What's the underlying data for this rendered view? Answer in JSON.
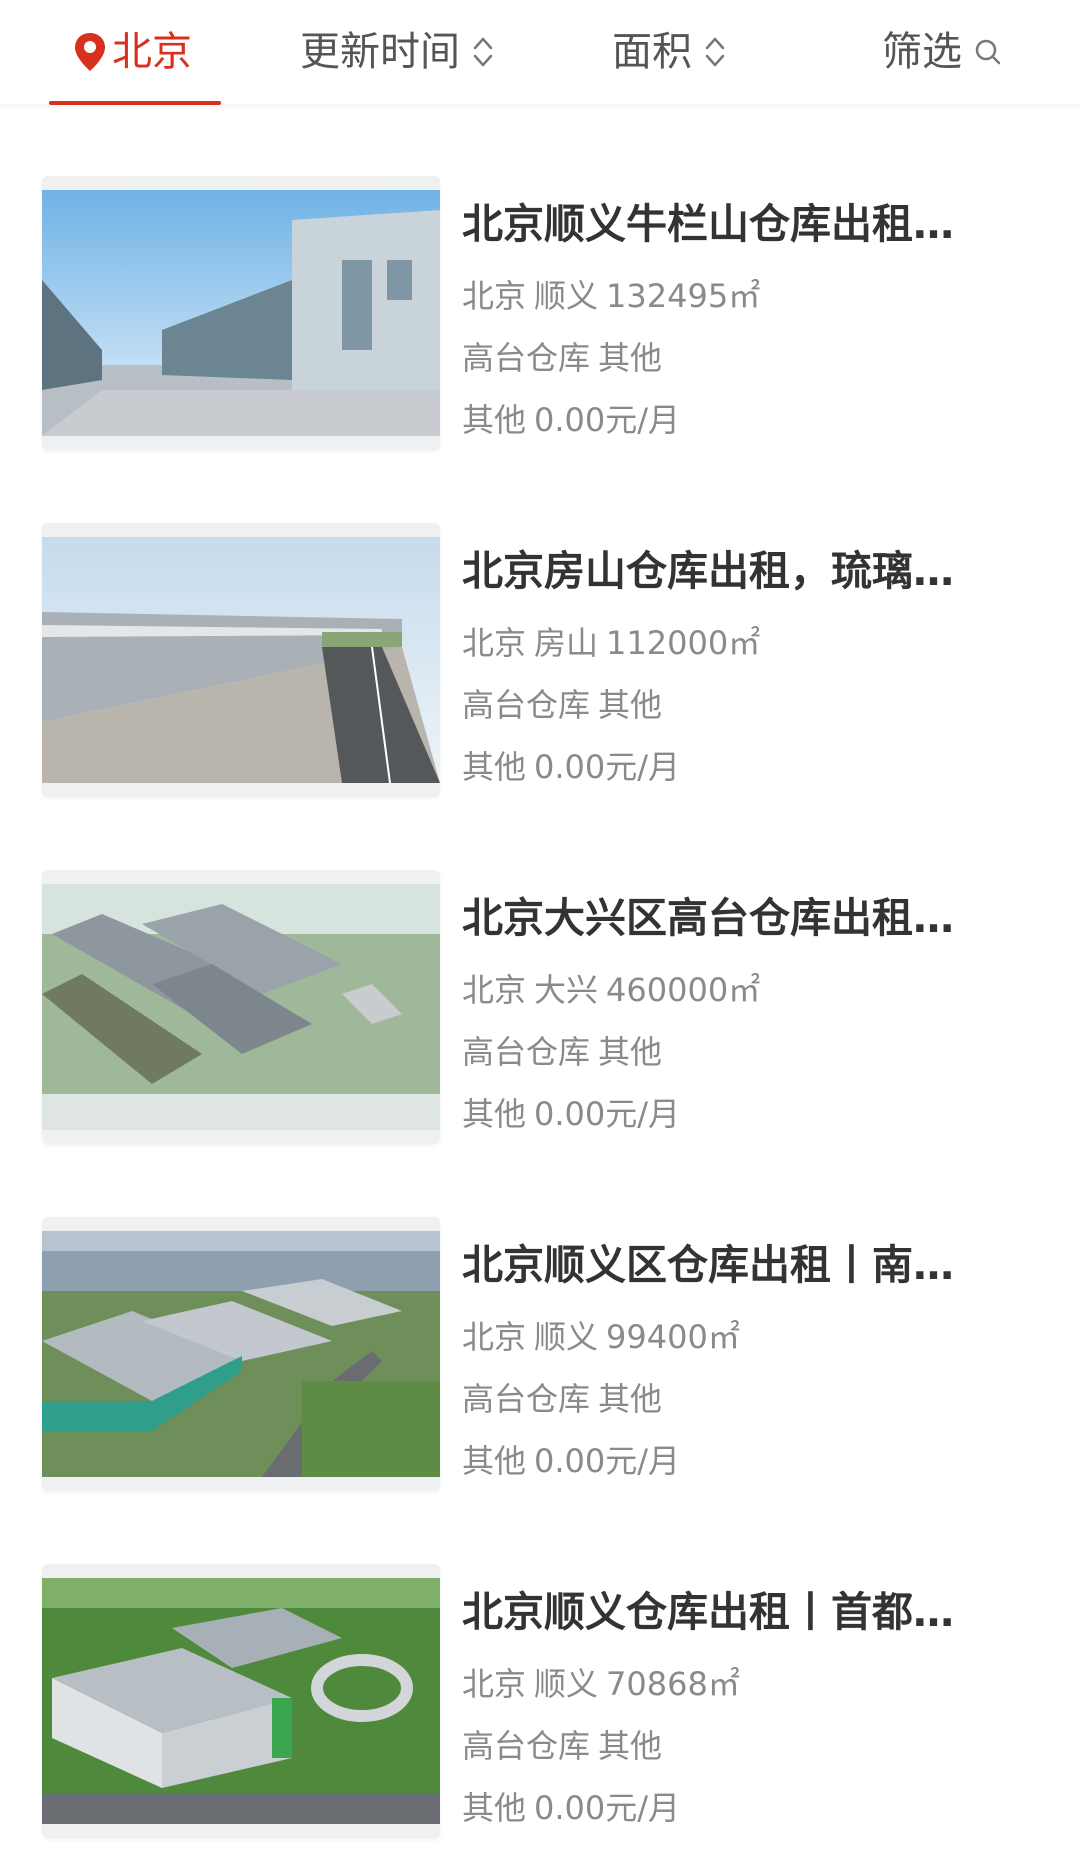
{
  "filter_bar": {
    "city": "北京",
    "sort_update": "更新时间",
    "sort_area": "面积",
    "filter": "筛选"
  },
  "colors": {
    "accent": "#d8301e",
    "title_text": "#333333",
    "meta_text": "#8a8a8a"
  },
  "listings": [
    {
      "title": "北京顺义牛栏山仓库出租…",
      "city": "北京",
      "district": "顺义",
      "area": "132495㎡",
      "warehouse_type": "高台仓库",
      "category": "其他",
      "price_type": "其他",
      "price": "0.00元/月"
    },
    {
      "title": "北京房山仓库出租，琉璃…",
      "city": "北京",
      "district": "房山",
      "area": "112000㎡",
      "warehouse_type": "高台仓库",
      "category": "其他",
      "price_type": "其他",
      "price": "0.00元/月"
    },
    {
      "title": "北京大兴区高台仓库出租…",
      "city": "北京",
      "district": "大兴",
      "area": "460000㎡",
      "warehouse_type": "高台仓库",
      "category": "其他",
      "price_type": "其他",
      "price": "0.00元/月"
    },
    {
      "title": "北京顺义区仓库出租丨南…",
      "city": "北京",
      "district": "顺义",
      "area": "99400㎡",
      "warehouse_type": "高台仓库",
      "category": "其他",
      "price_type": "其他",
      "price": "0.00元/月"
    },
    {
      "title": "北京顺义仓库出租丨首都…",
      "city": "北京",
      "district": "顺义",
      "area": "70868㎡",
      "warehouse_type": "高台仓库",
      "category": "其他",
      "price_type": "其他",
      "price": "0.00元/月"
    }
  ]
}
